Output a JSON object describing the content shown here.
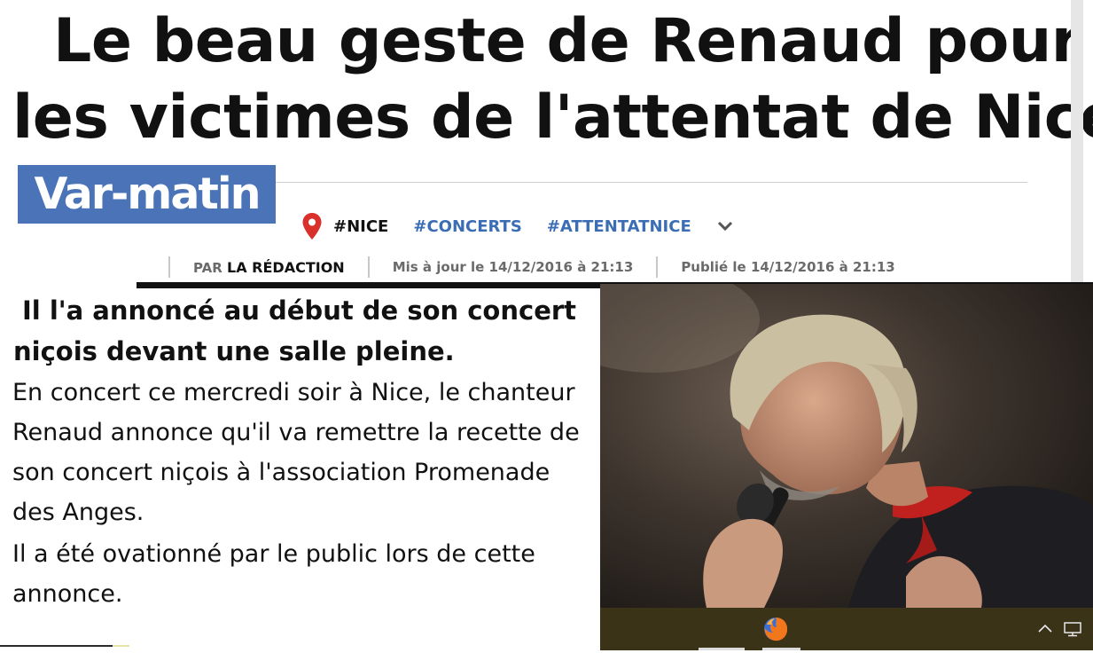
{
  "article": {
    "title_line1": "Le beau geste de Renaud pour",
    "title_line2": "les victimes de l'attentat de Nice",
    "source_logo": "Var-matin",
    "tags": [
      "#NICE",
      "#CONCERTS",
      "#ATTENTATNICE"
    ],
    "byline": {
      "par_label": "PAR",
      "author": "LA RÉDACTION",
      "updated": "Mis à jour le 14/12/2016 à 21:13",
      "published": "Publié le 14/12/2016 à 21:13"
    },
    "lead_line1": "Il l'a annoncé au début de son concert",
    "lead_line2": "niçois devant une salle pleine.",
    "paragraphs": [
      "En concert ce mercredi soir à Nice, le chanteur Renaud annonce qu'il va remettre la recette de son concert niçois à l'association Promenade des Anges.",
      "Il a été ovationné par le public lors de cette annonce."
    ]
  },
  "icons": {
    "location": "map-pin-icon",
    "more_tags": "chevron-down-icon",
    "browser": "firefox-icon",
    "tray": "chevron-up-icon",
    "network": "monitor-icon"
  },
  "colors": {
    "logo_bg": "#4a73b8",
    "tag_link": "#3b6db5",
    "pin": "#d9302c",
    "taskbar": "#3a3318"
  }
}
